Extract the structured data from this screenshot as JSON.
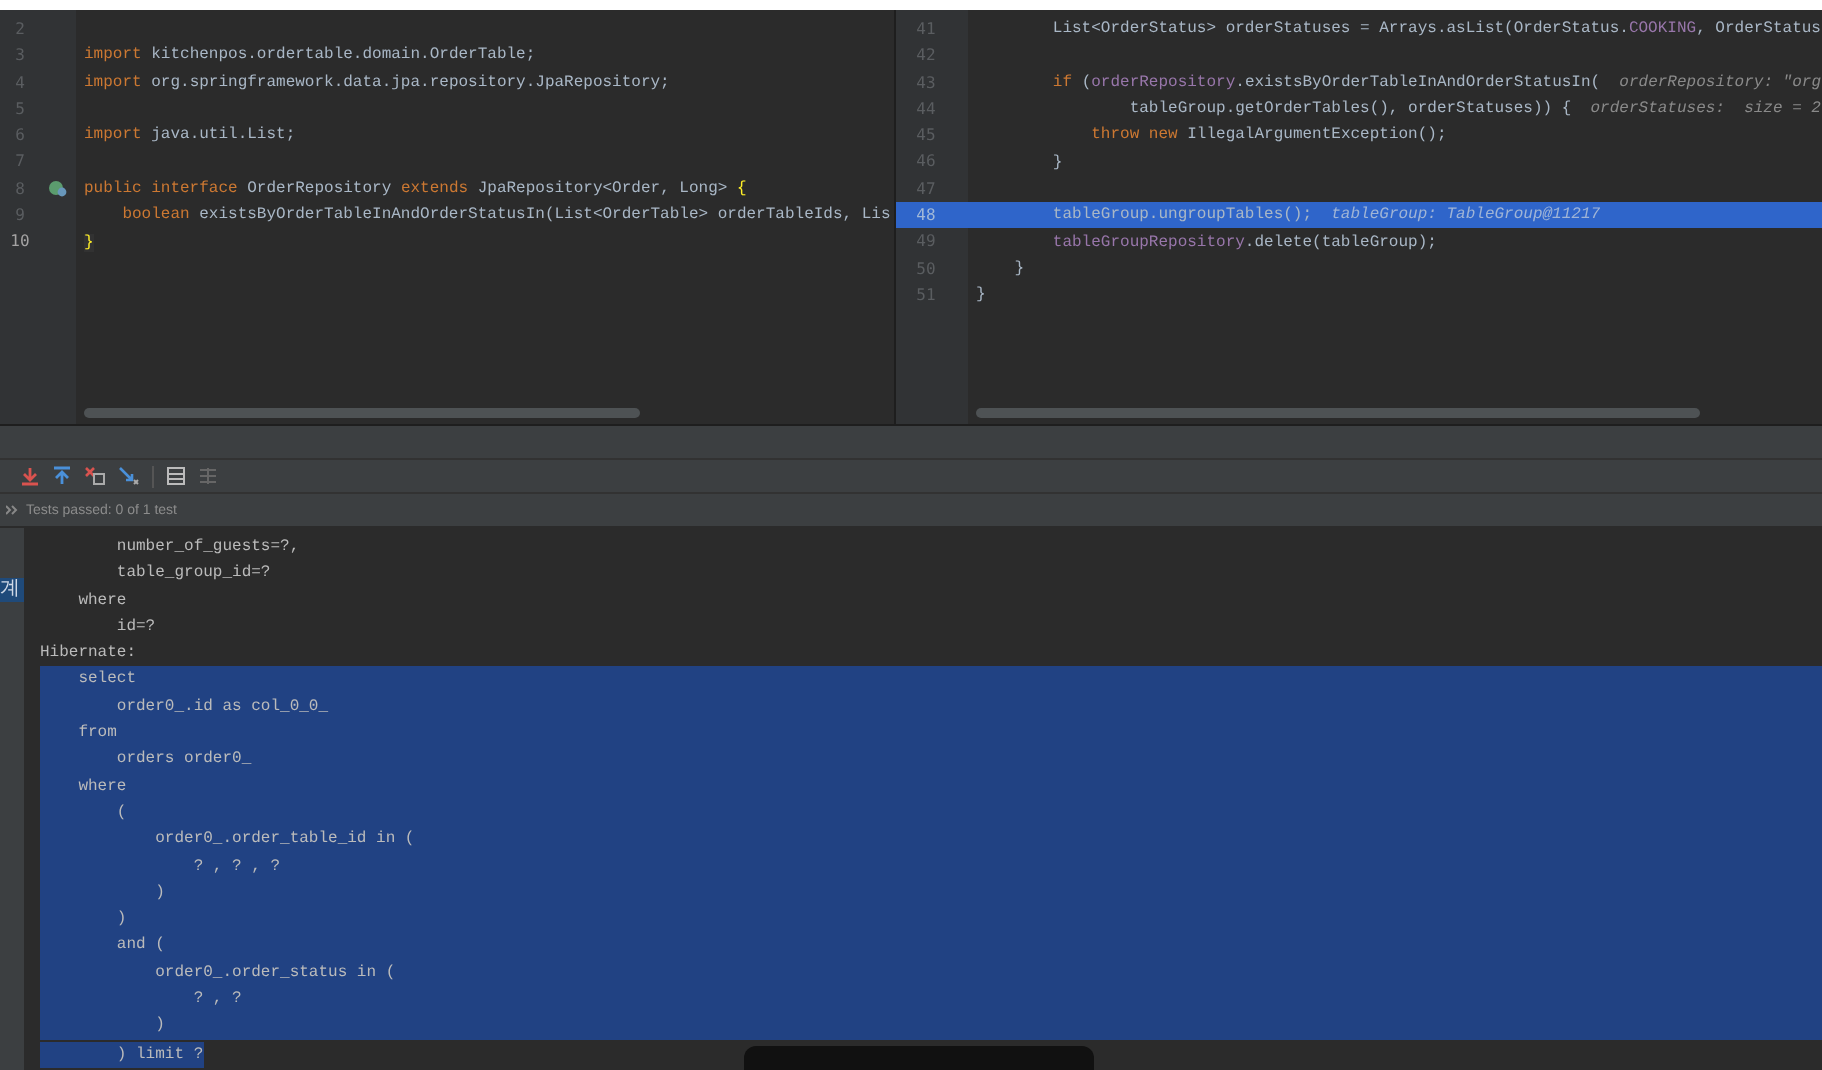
{
  "left_editor": {
    "lines": [
      {
        "number": "2",
        "current": false
      },
      {
        "number": "3",
        "current": false,
        "tokens": [
          {
            "text": "import",
            "kind": "keyword"
          },
          {
            "text": " kitchenpos.ordertable.domain.OrderTable;",
            "kind": "plain"
          }
        ]
      },
      {
        "number": "4",
        "current": false,
        "tokens": [
          {
            "text": "import",
            "kind": "keyword"
          },
          {
            "text": " org.springframework.data.jpa.repository.JpaRepository;",
            "kind": "plain"
          }
        ]
      },
      {
        "number": "5",
        "current": false
      },
      {
        "number": "6",
        "current": false,
        "tokens": [
          {
            "text": "import",
            "kind": "keyword"
          },
          {
            "text": " java.util.List;",
            "kind": "plain"
          }
        ]
      },
      {
        "number": "7",
        "current": false
      },
      {
        "number": "8",
        "current": false,
        "tokens": [
          {
            "text": "public interface",
            "kind": "keyword"
          },
          {
            "text": " OrderRepository ",
            "kind": "plain"
          },
          {
            "text": "extends",
            "kind": "keyword"
          },
          {
            "text": " JpaRepository<Order, Long> ",
            "kind": "plain"
          },
          {
            "text": "{",
            "kind": "brace"
          }
        ]
      },
      {
        "number": "9",
        "current": false,
        "tokens": [
          {
            "text": "    boolean",
            "kind": "keyword"
          },
          {
            "text": " existsByOrderTableInAndOrderStatusIn(List<OrderTable> orderTableIds, Lis",
            "kind": "plain"
          }
        ]
      },
      {
        "number": "10",
        "current": true,
        "tokens": [
          {
            "text": "}",
            "kind": "brace"
          }
        ]
      }
    ]
  },
  "right_editor": {
    "lines": [
      {
        "number": "41",
        "selected": false,
        "tokens": [
          {
            "text": "        List<OrderStatus> orderStatuses = Arrays.asList(OrderStatus.",
            "kind": "plain"
          },
          {
            "text": "COOKING",
            "kind": "field"
          },
          {
            "text": ", OrderStatus",
            "kind": "plain"
          }
        ]
      },
      {
        "number": "42",
        "selected": false
      },
      {
        "number": "43",
        "selected": false,
        "tokens": [
          {
            "text": "        if",
            "kind": "keyword"
          },
          {
            "text": " (",
            "kind": "plain"
          },
          {
            "text": "orderRepository",
            "kind": "field"
          },
          {
            "text": ".existsByOrderTableInAndOrderStatusIn(",
            "kind": "plain"
          },
          {
            "text": "  orderRepository: \"org",
            "kind": "hint"
          }
        ]
      },
      {
        "number": "44",
        "selected": false,
        "tokens": [
          {
            "text": "                tableGroup.getOrderTables(), orderStatuses)) {",
            "kind": "plain"
          },
          {
            "text": "  orderStatuses:  size = 2",
            "kind": "hint"
          }
        ]
      },
      {
        "number": "45",
        "selected": false,
        "tokens": [
          {
            "text": "            throw new",
            "kind": "keyword"
          },
          {
            "text": " IllegalArgumentException();",
            "kind": "plain"
          }
        ]
      },
      {
        "number": "46",
        "selected": false,
        "tokens": [
          {
            "text": "        }",
            "kind": "plain"
          }
        ]
      },
      {
        "number": "47",
        "selected": false
      },
      {
        "number": "48",
        "selected": true,
        "tokens": [
          {
            "text": "        tableGroup.ungroupTables();",
            "kind": "plain"
          },
          {
            "text": "  tableGroup: TableGroup@11217",
            "kind": "hint"
          }
        ]
      },
      {
        "number": "49",
        "selected": false,
        "tokens": [
          {
            "text": "        tableGroupRepository",
            "kind": "field"
          },
          {
            "text": ".delete(tableGroup);",
            "kind": "plain"
          }
        ]
      },
      {
        "number": "50",
        "selected": false,
        "tokens": [
          {
            "text": "    }",
            "kind": "plain"
          }
        ]
      },
      {
        "number": "51",
        "selected": false,
        "tokens": [
          {
            "text": "}",
            "kind": "plain"
          }
        ]
      }
    ]
  },
  "test_status": "Tests passed: 0 of 1 test",
  "side_label": "계",
  "console": {
    "lines": [
      {
        "text": "        number_of_guests=?,",
        "selected": false
      },
      {
        "text": "        table_group_id=?",
        "selected": false
      },
      {
        "text": "    where",
        "selected": false
      },
      {
        "text": "        id=?",
        "selected": false
      },
      {
        "text": "Hibernate:",
        "selected": false
      },
      {
        "text": "    select",
        "selected": true
      },
      {
        "text": "        order0_.id as col_0_0_",
        "selected": true
      },
      {
        "text": "    from",
        "selected": true
      },
      {
        "text": "        orders order0_",
        "selected": true
      },
      {
        "text": "    where",
        "selected": true
      },
      {
        "text": "        (",
        "selected": true
      },
      {
        "text": "            order0_.order_table_id in (",
        "selected": true
      },
      {
        "text": "                ? , ? , ?",
        "selected": true
      },
      {
        "text": "            )",
        "selected": true
      },
      {
        "text": "        )",
        "selected": true
      },
      {
        "text": "        and (",
        "selected": true
      },
      {
        "text": "            order0_.order_status in (",
        "selected": true
      },
      {
        "text": "                ? , ?",
        "selected": true
      },
      {
        "text": "            )",
        "selected": true
      },
      {
        "text": "        ) limit ?",
        "selected": true
      }
    ]
  }
}
